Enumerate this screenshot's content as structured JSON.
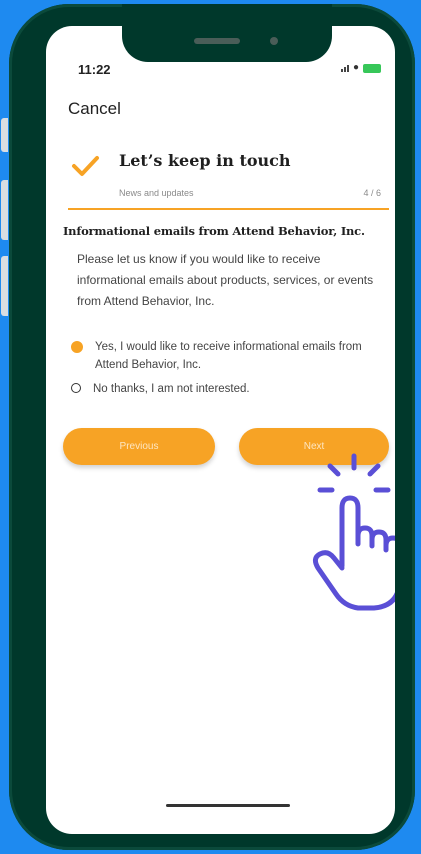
{
  "status_bar": {
    "time": "11:22"
  },
  "nav": {
    "cancel_label": "Cancel"
  },
  "step": {
    "title": "Let’s keep in touch",
    "subtitle": "News and updates",
    "counter": "4 / 6"
  },
  "section": {
    "title": "Informational emails from Attend Behavior, Inc.",
    "description": "Please let us know if you would like to receive informational emails about products, services, or events from Attend Behavior, Inc."
  },
  "options": [
    {
      "label": "Yes, I would like to receive informational emails from Attend Behavior, Inc.",
      "selected": true
    },
    {
      "label": "No thanks, I am not interested.",
      "selected": false
    }
  ],
  "buttons": {
    "previous_label": "Previous",
    "next_label": "Next"
  },
  "colors": {
    "accent": "#f7a325",
    "frame": "#00382b",
    "background": "#1e8af0",
    "hand": "#5a4fd6"
  }
}
